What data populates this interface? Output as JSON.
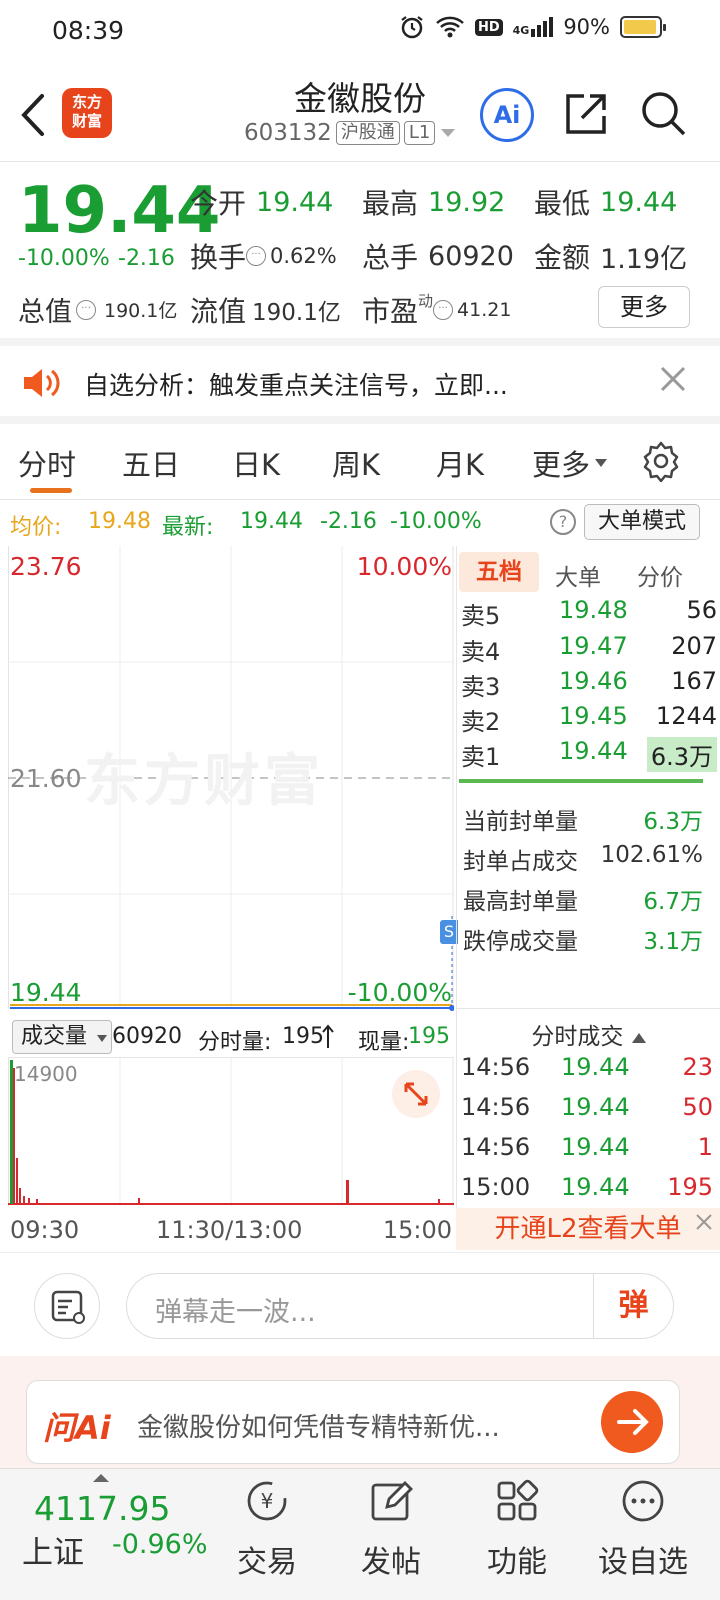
{
  "status": {
    "time": "08:39",
    "battery": "90%",
    "hd": "HD",
    "net": "4G"
  },
  "header": {
    "title": "金徽股份",
    "code": "603132",
    "tag_connect": "沪股通",
    "tag_level": "L1",
    "logo_line1": "东方",
    "logo_line2": "财富",
    "ai_label": "Ai"
  },
  "quote": {
    "price": "19.44",
    "change_pct": "-10.00%",
    "change_amt": "-2.16",
    "open_label": "今开",
    "open": "19.44",
    "high_label": "最高",
    "high": "19.92",
    "low_label": "最低",
    "low": "19.44",
    "turnover_label": "换手",
    "turnover": "0.62%",
    "volume_label": "总手",
    "volume": "60920",
    "amount_label": "金额",
    "amount": "1.19亿",
    "total_value_label": "总值",
    "total_value": "190.1亿",
    "float_value_label": "流值",
    "float_value": "190.1亿",
    "pe_label": "市盈",
    "pe_sup": "动",
    "pe": "41.21",
    "more": "更多"
  },
  "notice": {
    "text": "自选分析：触发重点关注信号，立即..."
  },
  "tabs": {
    "items": [
      "分时",
      "五日",
      "日K",
      "周K",
      "月K",
      "更多"
    ],
    "active": 0
  },
  "avg_row": {
    "avg_label": "均价:",
    "avg": "19.48",
    "latest_label": "最新:",
    "latest": "19.44",
    "chg": "-2.16",
    "pct": "-10.00%",
    "help": "?",
    "big_order": "大单模式"
  },
  "chart": {
    "top_price": "23.76",
    "top_pct": "10.00%",
    "mid_price": "21.60",
    "bottom_price": "19.44",
    "bottom_pct": "-10.00%",
    "watermark": "东方财富",
    "marker": "S",
    "avg_color": "#e8a61c",
    "price_color": "#2f6de8"
  },
  "depth": {
    "tabs": [
      "五档",
      "大单",
      "分价"
    ],
    "asks": [
      {
        "label": "卖5",
        "price": "19.48",
        "vol": "56"
      },
      {
        "label": "卖4",
        "price": "19.47",
        "vol": "207"
      },
      {
        "label": "卖3",
        "price": "19.46",
        "vol": "167"
      },
      {
        "label": "卖2",
        "price": "19.45",
        "vol": "1244"
      },
      {
        "label": "卖1",
        "price": "19.44",
        "vol": "6.3万"
      }
    ],
    "seal": [
      {
        "label": "当前封单量",
        "value": "6.3万"
      },
      {
        "label": "封单占成交",
        "value": "102.61%"
      },
      {
        "label": "最高封单量",
        "value": "6.7万"
      },
      {
        "label": "跌停成交量",
        "value": "3.1万"
      }
    ]
  },
  "volume": {
    "dropdown": "成交量",
    "total": "60920",
    "minute_label": "分时量:",
    "minute": "195",
    "current_label": "现量:",
    "current": "195",
    "max": "14900"
  },
  "time_axis": [
    "09:30",
    "11:30/13:00",
    "15:00"
  ],
  "ticks": {
    "header": "分时成交",
    "rows": [
      {
        "time": "14:56",
        "price": "19.44",
        "vol": "23"
      },
      {
        "time": "14:56",
        "price": "19.44",
        "vol": "50"
      },
      {
        "time": "14:56",
        "price": "19.44",
        "vol": "1"
      },
      {
        "time": "15:00",
        "price": "19.44",
        "vol": "195"
      }
    ],
    "l2_banner": "开通L2查看大单"
  },
  "danmu": {
    "placeholder": "弹幕走一波...",
    "send": "弹"
  },
  "askai": {
    "logo": "问Ai",
    "text": "金徽股份如何凭借专精特新优..."
  },
  "bottom_nav": {
    "index_value": "4117.95",
    "index_name": "上证",
    "index_pct": "-0.96%",
    "items": [
      "交易",
      "发帖",
      "功能",
      "设自选"
    ]
  }
}
